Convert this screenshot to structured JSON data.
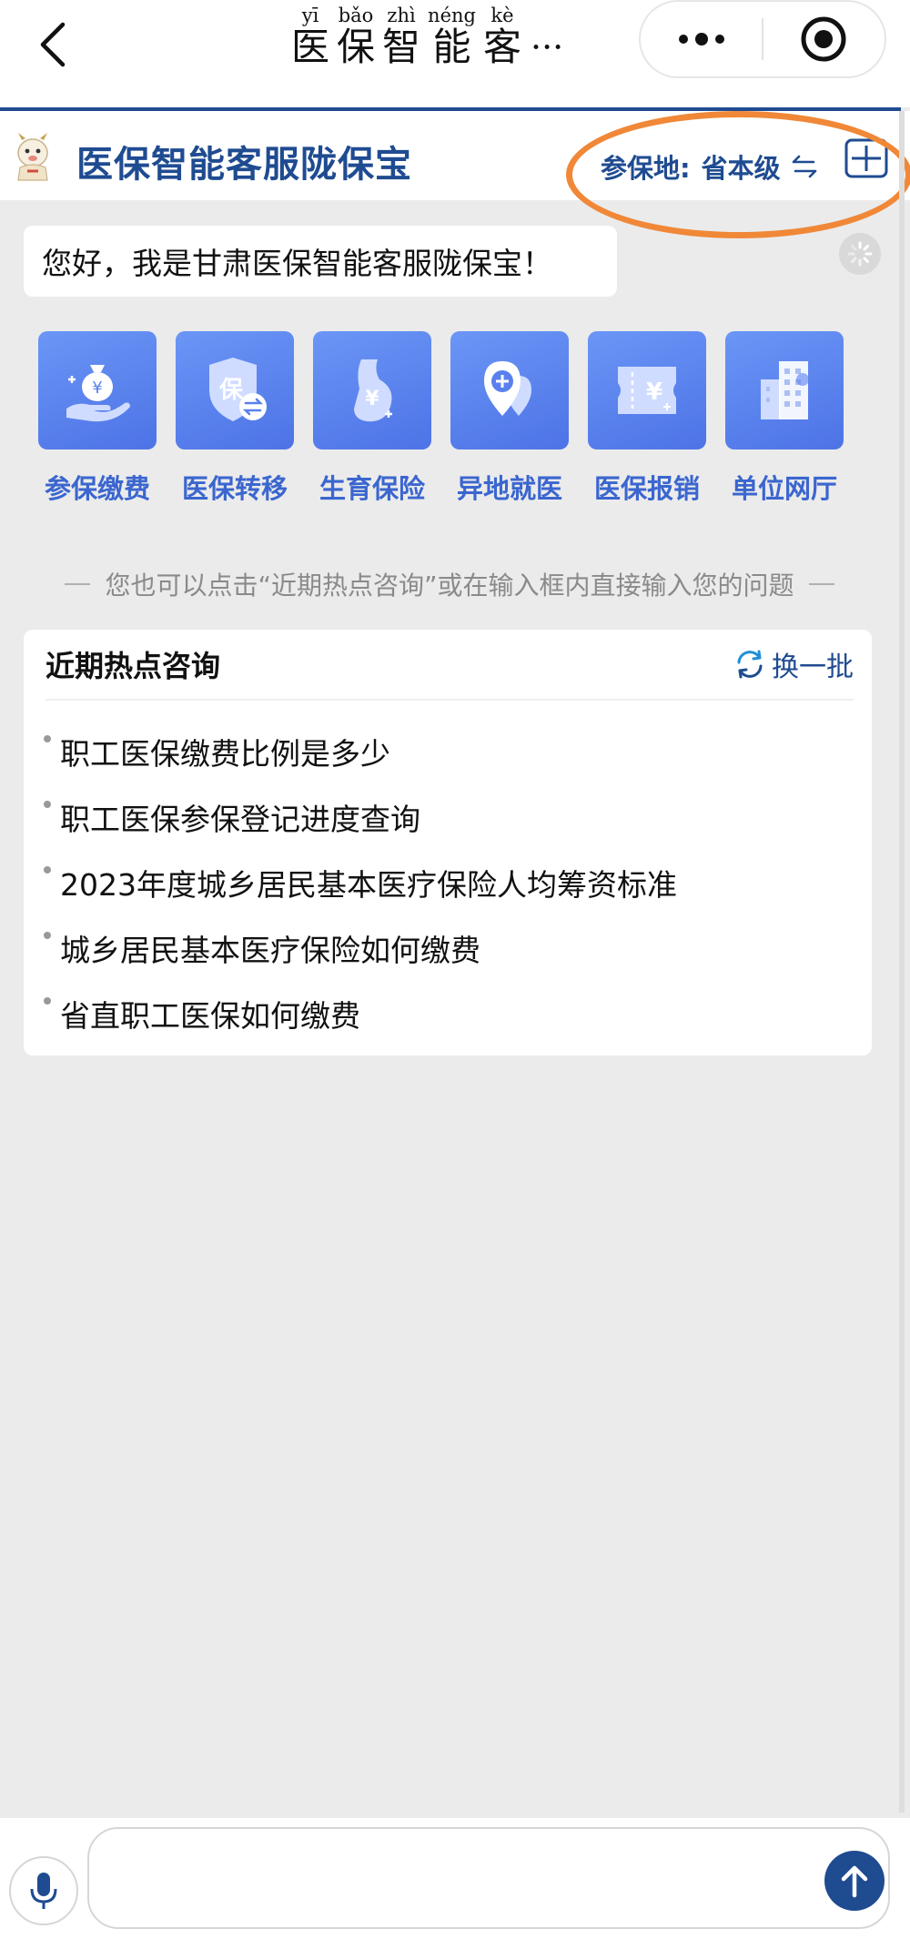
{
  "nav": {
    "title_chars": [
      {
        "pinyin": "yī",
        "char": "医"
      },
      {
        "pinyin": "bǎo",
        "char": "保"
      },
      {
        "pinyin": "zhì",
        "char": "智"
      },
      {
        "pinyin": "néng",
        "char": "能"
      },
      {
        "pinyin": "kè",
        "char": "客"
      }
    ],
    "title_ellipsis": "···"
  },
  "header": {
    "brand": "医保智能客服陇保宝",
    "region_label": "参保地:",
    "region_value": "省本级"
  },
  "greeting": "您好，我是甘肃医保智能客服陇保宝！",
  "services": [
    {
      "label": "参保缴费",
      "icon": "money-bag-hand-icon"
    },
    {
      "label": "医保转移",
      "icon": "shield-transfer-icon"
    },
    {
      "label": "生育保险",
      "icon": "maternity-yuan-icon"
    },
    {
      "label": "异地就医",
      "icon": "location-medical-icon"
    },
    {
      "label": "医保报销",
      "icon": "ticket-yuan-icon"
    },
    {
      "label": "单位网厅",
      "icon": "office-building-icon"
    }
  ],
  "hint": "您也可以点击“近期热点咨询”或在输入框内直接输入您的问题",
  "hot": {
    "title": "近期热点咨询",
    "refresh_label": "换一批",
    "items": [
      "职工医保缴费比例是多少",
      "职工医保参保登记进度查询",
      "2023年度城乡居民基本医疗保险人均筹资标准",
      "城乡居民基本医疗保险如何缴费",
      "省直职工医保如何缴费"
    ]
  },
  "input": {
    "placeholder": ""
  },
  "colors": {
    "brand_blue": "#1f4b91",
    "tile_blue": "#5a80ee",
    "label_blue": "#3b66cf",
    "highlight_orange": "#f08838",
    "background": "#ebebeb"
  }
}
